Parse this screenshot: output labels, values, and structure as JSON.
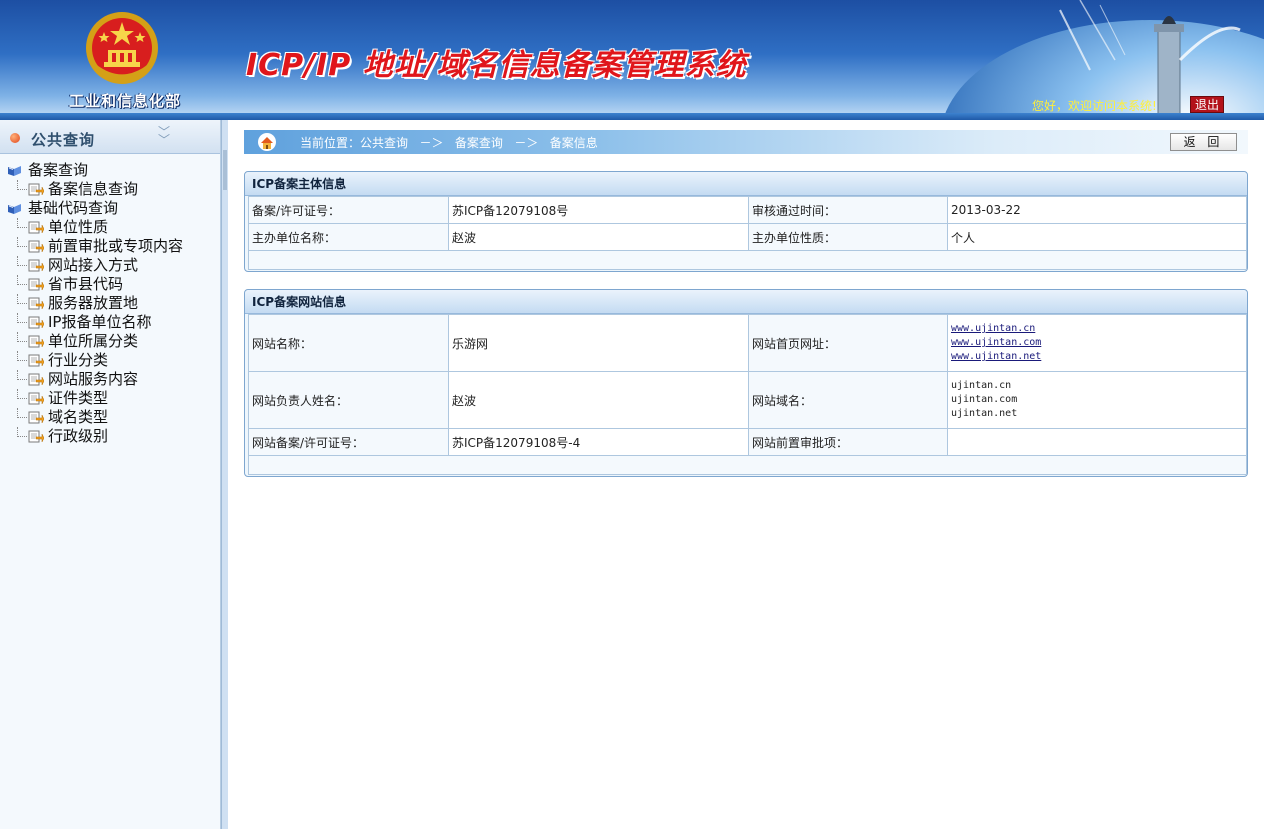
{
  "header": {
    "org_name": "工业和信息化部",
    "system_title": "ICP/IP 地址/域名信息备案管理系统",
    "welcome": "您好，欢迎访问本系统!",
    "logout_label": "退出"
  },
  "sidebar": {
    "title": "公共查询",
    "items": [
      {
        "label": "备案查询",
        "level": "root"
      },
      {
        "label": "备案信息查询",
        "level": "child"
      },
      {
        "label": "基础代码查询",
        "level": "root"
      },
      {
        "label": "单位性质",
        "level": "child"
      },
      {
        "label": "前置审批或专项内容",
        "level": "child"
      },
      {
        "label": "网站接入方式",
        "level": "child"
      },
      {
        "label": "省市县代码",
        "level": "child"
      },
      {
        "label": "服务器放置地",
        "level": "child"
      },
      {
        "label": "IP报备单位名称",
        "level": "child"
      },
      {
        "label": "单位所属分类",
        "level": "child"
      },
      {
        "label": "行业分类",
        "level": "child"
      },
      {
        "label": "网站服务内容",
        "level": "child"
      },
      {
        "label": "证件类型",
        "level": "child"
      },
      {
        "label": "域名类型",
        "level": "child"
      },
      {
        "label": "行政级别",
        "level": "child"
      }
    ]
  },
  "breadcrumb": {
    "text": "当前位置：公共查询   －＞   备案查询   －＞   备案信息",
    "back_label": "返 回"
  },
  "subject_panel": {
    "title": "ICP备案主体信息",
    "rows": [
      {
        "k1": "备案/许可证号：",
        "v1": "苏ICP备12079108号",
        "k2": "审核通过时间：",
        "v2": "2013-03-22"
      },
      {
        "k1": "主办单位名称：",
        "v1": "赵波",
        "k2": "主办单位性质：",
        "v2": "个人"
      }
    ]
  },
  "site_panel": {
    "title": "ICP备案网站信息",
    "site_name_label": "网站名称：",
    "site_name": "乐游网",
    "homepage_label": "网站首页网址：",
    "homepages": [
      "www.ujintan.cn",
      "www.ujintan.com",
      "www.ujintan.net"
    ],
    "owner_label": "网站负责人姓名：",
    "owner": "赵波",
    "domain_label": "网站域名：",
    "domains": [
      "ujintan.cn",
      "ujintan.com",
      "ujintan.net"
    ],
    "license_label": "网站备案/许可证号：",
    "license": "苏ICP备12079108号-4",
    "preapproval_label": "网站前置审批项：",
    "preapproval": ""
  },
  "colors": {
    "header_blue": "#2f6fc4",
    "title_red": "#e0161b",
    "logout_red": "#b3121a",
    "welcome_yellow": "#ffef3a"
  }
}
